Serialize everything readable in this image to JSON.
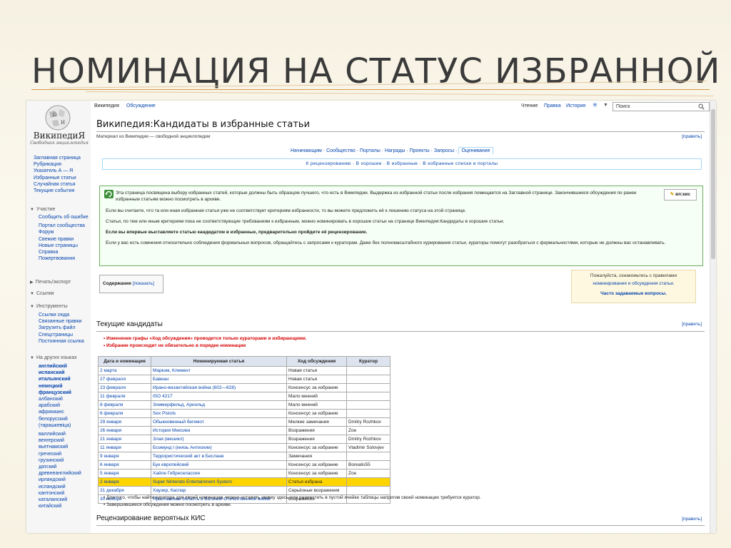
{
  "slide": {
    "title": "НОМИНАЦИЯ НА СТАТУС ИЗБРАННОЙ"
  },
  "sidebar": {
    "wordmark": "ВикипедиЯ",
    "tagline": "Свободная энциклопедия",
    "main": [
      "Заглавная страница",
      "Рубрикация",
      "Указатель А — Я",
      "Избранные статьи",
      "Случайная статья",
      "Текущие события"
    ],
    "participation": {
      "header": "Участие",
      "items": [
        "Сообщить об ошибке",
        "Портал сообщества",
        "Форум",
        "Свежие правки",
        "Новые страницы",
        "Справка",
        "Пожертвования"
      ]
    },
    "print": "Печать/экспорт",
    "links": "Ссылки",
    "tools": {
      "header": "Инструменты",
      "items": [
        "Ссылки сюда",
        "Связанные правки",
        "Загрузить файл",
        "Спецстраницы",
        "Постоянная ссылка"
      ]
    },
    "langs": {
      "header": "На других языках",
      "items": [
        "английский",
        "испанский",
        "итальянский",
        "немецкий",
        "французский",
        "албанский",
        "арабский",
        "африкаанс",
        "белорусский (тарашкевіца)",
        "валлийский",
        "венгерский",
        "вьетнамский",
        "греческий",
        "грузинский",
        "датский",
        "древнеанглийский",
        "ирландский",
        "исландский",
        "кантонский",
        "каталанский",
        "китайский"
      ]
    }
  },
  "topbar": {
    "tab_page": "Википедия",
    "tab_talk": "Обсуждение",
    "read": "Чтение",
    "edit": "Правка",
    "history": "История",
    "search_placeholder": "Поиск"
  },
  "page": {
    "title": "Википедия:Кандидаты в избранные статьи",
    "from": "Материал из Википедии — свободной энциклопедии",
    "edit": "[править]",
    "portal_tabs": "Начинающим · Сообщество · Порталы · Награды · Проекты · Запросы ·",
    "portal_current": "Оценивание",
    "portal_sub": "К рецензированию · В хорошие · В избранные · В избранные списки и порталы",
    "vpkis": "вп:кис",
    "notice1": "Эта страница посвящена выбору избранных статей, которые должны быть образцом лучшего, что есть в Википедии. Выдержка из избранной статьи после избрания помещается на Заглавной странице. Закончившиеся обсуждения по ранее избранным статьям можно посмотреть в архиве.",
    "notice2": "Если вы считаете, что та или иная избранная статья уже не соответствует критериям избранности, то вы можете предложить её к лишению статуса на этой странице.",
    "notice3": "Статьи, по тем или иным критериям пока не соответствующие требованиям к избранным, можно номинировать в хорошие статьи на странице Википедия:Кандидаты в хорошие статьи.",
    "notice4": "Если вы впервые выставляете статью кандидатом в избранные, предварительно пройдите её рецензирование.",
    "notice5": "Если у вас есть сомнения относительно соблюдения формальных вопросов, обращайтесь с запросами к кураторам. Даже без полномасштабного курирования статьи, кураторы помогут разобраться с формальностями, которые не должны вас останавливать.",
    "toc": "Содержание",
    "toc_show": "[показать]",
    "info1": "Пожалуйста, ознакомьтесь с правилами",
    "info2": "номинирования и обсуждения статьи.",
    "info3": "Часто задаваемые вопросы.",
    "h2_current": "Текущие кандидаты",
    "bullet1": "Изменение графы «Ход обсуждения» проводится только кураторами и избирающими.",
    "bullet2": "Избрание происходит не обязательно в порядке номинации",
    "h2_review": "Рецензирование вероятных КИС",
    "foot1": "Для того, чтобы найти куратора для своей номинации, можно оставить заявку здесь или разместить в пустой ячейке таблицы напротив своей номинации требуется куратор.",
    "foot2": "Завершившиеся обсуждения можно посмотреть в архиве."
  },
  "table": {
    "headers": [
      "Дата и номинация",
      "Номинируемая статья",
      "Ход обсуждения",
      "Куратор"
    ],
    "rows": [
      [
        "2 марта",
        "Маркэм, Клемент",
        "Новая статья",
        ""
      ],
      [
        "27 февраля",
        "Бавеан",
        "Новая статья",
        ""
      ],
      [
        "23 февраля",
        "Ирано-византийская война (602—628)",
        "Консенсус за избрание",
        ""
      ],
      [
        "11 февраля",
        "ISO 4217",
        "Мало мнений",
        ""
      ],
      [
        "8 февраля",
        "Зоммерфельд, Арнольд",
        "Мало мнений",
        ""
      ],
      [
        "6 февраля",
        "Sex Pistols",
        "Консенсус за избрание",
        ""
      ],
      [
        "29 января",
        "Обыкновенный бегемот",
        "Мелкие замечания",
        "Dmitry Rozhkov"
      ],
      [
        "26 января",
        "История Мексики",
        "Возражения",
        "Zoe"
      ],
      [
        "21 января",
        "Злая (мюзикл)",
        "Возражения",
        "Dmitry Rozhkov"
      ],
      [
        "11 января",
        "Боэмунд I (князь Антиохии)",
        "Консенсус за избрание",
        "Vladimir Solovjev"
      ],
      [
        "9 января",
        "Террористический акт в Беслане",
        "Замечания",
        ""
      ],
      [
        "6 января",
        "Бук европейский",
        "Консенсус за избрание",
        "Borealis55"
      ],
      [
        "5 января",
        "Хайле Гебреселассие",
        "Консенсус за избрание",
        "Zoe"
      ],
      [
        "2 января",
        "Super Nintendo Entertainment System",
        "Статья избрана",
        ""
      ],
      [
        "31 декабря",
        "Хаузер, Каспар",
        "Серьёзные возражения",
        ""
      ],
      [
        "30 ноября",
        "Ярославская область в Великой Отечественной войне",
        "Возражения",
        ""
      ]
    ],
    "highlight_row": 13,
    "highlight_color": "#ffd500"
  }
}
